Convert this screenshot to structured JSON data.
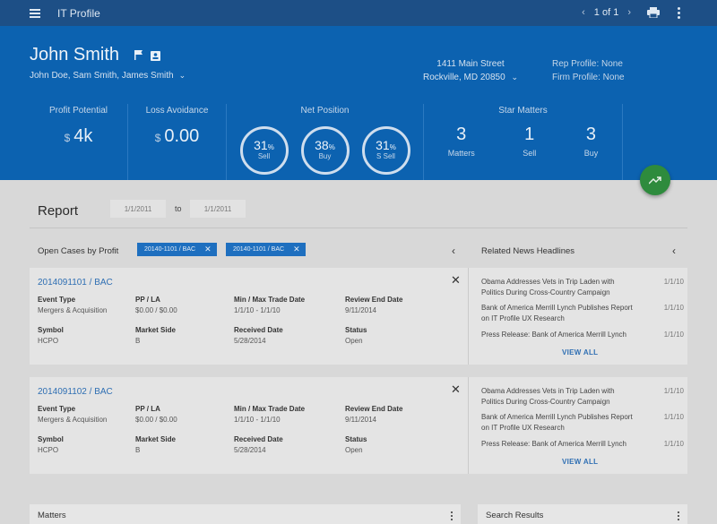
{
  "appbar": {
    "title": "IT Profile",
    "pager": "1 of 1"
  },
  "profile": {
    "name": "John Smith",
    "aliases": "John Doe, Sam Smith, James Smith",
    "address_line1": "1411 Main Street",
    "address_line2": "Rockville, MD 20850",
    "rep_profile": "Rep Profile: None",
    "firm_profile": "Firm Profile: None"
  },
  "metrics": {
    "profit_label": "Profit Potential",
    "profit_currency": "$",
    "profit_value": "4k",
    "loss_label": "Loss Avoidance",
    "loss_currency": "$",
    "loss_value": "0.00",
    "net_label": "Net Position",
    "rings": [
      {
        "value": "31",
        "unit": "%",
        "label": "Sell"
      },
      {
        "value": "38",
        "unit": "%",
        "label": "Buy"
      },
      {
        "value": "31",
        "unit": "%",
        "label": "S Sell"
      }
    ],
    "star_label": "Star Matters",
    "stars": [
      {
        "value": "3",
        "label": "Matters"
      },
      {
        "value": "1",
        "label": "Sell"
      },
      {
        "value": "3",
        "label": "Buy"
      }
    ]
  },
  "report": {
    "title": "Report",
    "date_from": "1/1/2011",
    "to": "to",
    "date_to": "1/1/2011",
    "open_cases": "Open Cases by Profit",
    "chips": [
      "20140-1101 / BAC",
      "20140-1101 / BAC"
    ],
    "related_news": "Related News Headlines"
  },
  "cases": [
    {
      "id": "2014091101 / BAC",
      "event_type_k": "Event Type",
      "event_type_v": "Mergers & Acquisition",
      "pp_k": "PP / LA",
      "pp_v": "$0.00 / $0.00",
      "trade_k": "Min / Max Trade Date",
      "trade_v": "1/1/10 - 1/1/10",
      "review_k": "Review End Date",
      "review_v": "9/11/2014",
      "symbol_k": "Symbol",
      "symbol_v": "HCPO",
      "side_k": "Market Side",
      "side_v": "B",
      "recv_k": "Received Date",
      "recv_v": "5/28/2014",
      "status_k": "Status",
      "status_v": "Open",
      "news": [
        {
          "title": "Obama Addresses Vets in Trip Laden with Politics During Cross-Country Campaign",
          "date": "1/1/10"
        },
        {
          "title": "Bank of America Merrill Lynch Publishes Report on IT Profile UX Research",
          "date": "1/1/10"
        },
        {
          "title": "Press Release: Bank of America Merrill Lynch",
          "date": "1/1/10"
        }
      ],
      "view_all": "VIEW ALL"
    },
    {
      "id": "2014091102 / BAC",
      "event_type_k": "Event Type",
      "event_type_v": "Mergers & Acquisition",
      "pp_k": "PP / LA",
      "pp_v": "$0.00 / $0.00",
      "trade_k": "Min / Max Trade Date",
      "trade_v": "1/1/10 - 1/1/10",
      "review_k": "Review End Date",
      "review_v": "9/11/2014",
      "symbol_k": "Symbol",
      "symbol_v": "HCPO",
      "side_k": "Market Side",
      "side_v": "B",
      "recv_k": "Received Date",
      "recv_v": "5/28/2014",
      "status_k": "Status",
      "status_v": "Open",
      "news": [
        {
          "title": "Obama Addresses Vets in Trip Laden with Politics During Cross-Country Campaign",
          "date": "1/1/10"
        },
        {
          "title": "Bank of America Merrill Lynch Publishes Report on IT Profile UX Research",
          "date": "1/1/10"
        },
        {
          "title": "Press Release: Bank of America Merrill Lynch",
          "date": "1/1/10"
        }
      ],
      "view_all": "VIEW ALL"
    }
  ],
  "panels": {
    "matters": "Matters",
    "search": "Search Results"
  }
}
